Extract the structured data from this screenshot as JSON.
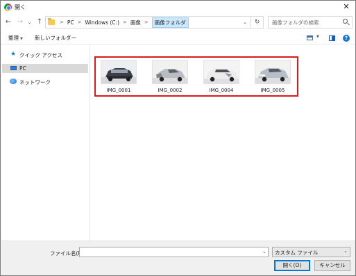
{
  "window": {
    "title": "開く",
    "close_label": "✕"
  },
  "nav": {
    "back": "←",
    "forward": "→",
    "recent": "⌄",
    "up": "↑"
  },
  "address": {
    "crumbs": [
      "PC",
      "Windows (C:)",
      "画像",
      "画像フォルダ"
    ],
    "separator": ">",
    "dropdown": "⌄",
    "refresh": "↻"
  },
  "search": {
    "placeholder": "画像フォルダの検索"
  },
  "toolbar": {
    "organize_label": "整理",
    "organize_caret": "▼",
    "new_folder_label": "新しいフォルダー",
    "view_caret": "▼",
    "help_label": "?"
  },
  "sidebar": {
    "items": [
      {
        "label": "クイック アクセス",
        "icon": "star-icon"
      },
      {
        "label": "PC",
        "icon": "computer-icon",
        "selected": true
      },
      {
        "label": "ネットワーク",
        "icon": "network-icon"
      }
    ]
  },
  "files": [
    {
      "name": "IMG_0001",
      "thumb_color": "#3c3f44",
      "selected": true
    },
    {
      "name": "IMG_0002",
      "thumb_color": "#b9bcc2",
      "selected": true
    },
    {
      "name": "IMG_0004",
      "thumb_color": "#ececec",
      "selected": true
    },
    {
      "name": "IMG_0005",
      "thumb_color": "#b8bec8",
      "selected": true
    }
  ],
  "bottom": {
    "filename_label": "ファイル名(N):",
    "filename_value": "",
    "filetype_value": "カスタム ファイル",
    "open_label": "開く(O)",
    "cancel_label": "キャンセル"
  },
  "colors": {
    "selection_outline": "#d81b1b",
    "accent": "#0078d7"
  }
}
